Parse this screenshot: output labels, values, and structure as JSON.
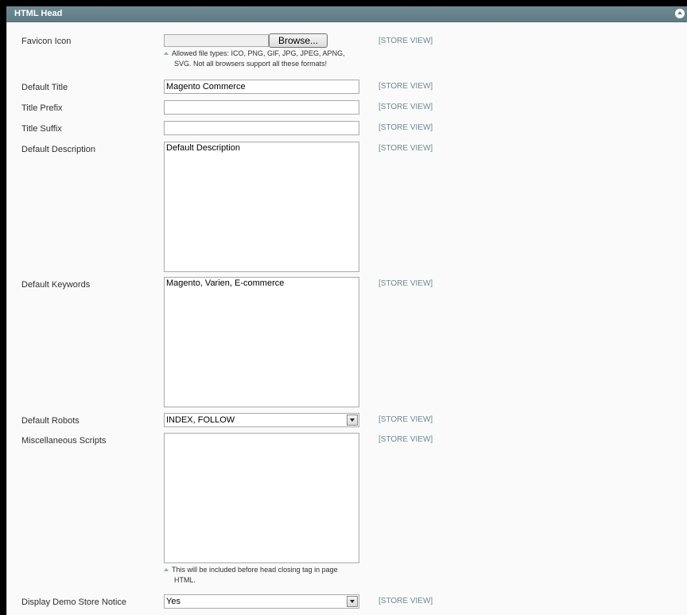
{
  "section": {
    "title": "HTML Head"
  },
  "scope_label": "[STORE VIEW]",
  "fields": {
    "favicon": {
      "label": "Favicon Icon",
      "browse_label": "Browse...",
      "note_line1": "Allowed file types: ICO, PNG, GIF, JPG, JPEG, APNG,",
      "note_line2": "SVG. Not all browsers support all these formats!"
    },
    "default_title": {
      "label": "Default Title",
      "value": "Magento Commerce"
    },
    "title_prefix": {
      "label": "Title Prefix",
      "value": ""
    },
    "title_suffix": {
      "label": "Title Suffix",
      "value": ""
    },
    "default_description": {
      "label": "Default Description",
      "value": "Default Description"
    },
    "default_keywords": {
      "label": "Default Keywords",
      "value": "Magento, Varien, E-commerce"
    },
    "default_robots": {
      "label": "Default Robots",
      "value": "INDEX, FOLLOW"
    },
    "misc_scripts": {
      "label": "Miscellaneous Scripts",
      "value": "",
      "note_line1": "This will be included before head closing tag in page",
      "note_line2": "HTML."
    },
    "demo_notice": {
      "label": "Display Demo Store Notice",
      "value": "Yes"
    }
  },
  "icons": {
    "collapse": "collapse-up-icon",
    "note": "note-triangle-icon",
    "dropdown": "chevron-down-icon"
  }
}
